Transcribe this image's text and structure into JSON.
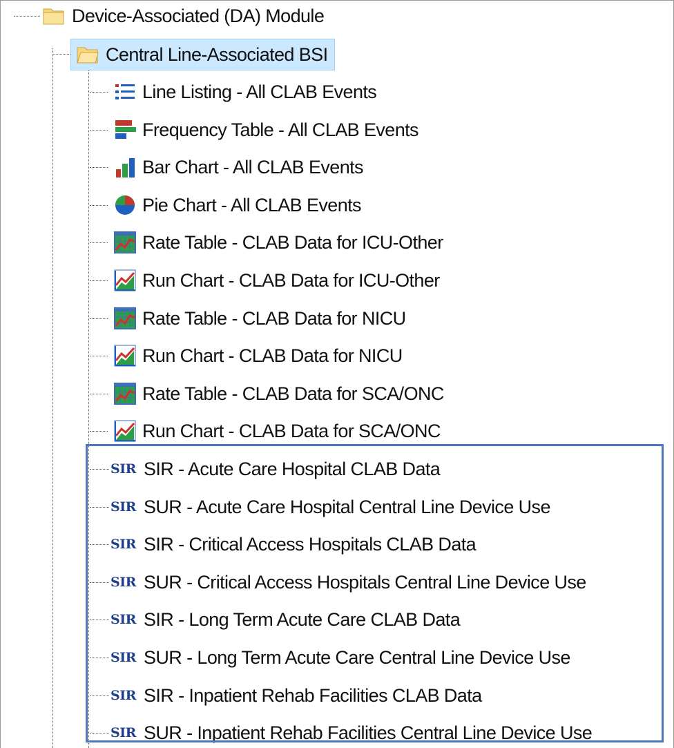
{
  "tree": {
    "root": {
      "label": "Device-Associated (DA) Module",
      "icon": "folder-icon"
    },
    "folder": {
      "label": "Central Line-Associated BSI",
      "icon": "folder-open-icon",
      "selected": true
    },
    "items": [
      {
        "label": "Line Listing - All CLAB Events",
        "icon": "line-listing-icon"
      },
      {
        "label": "Frequency Table - All CLAB Events",
        "icon": "frequency-table-icon"
      },
      {
        "label": "Bar Chart - All CLAB Events",
        "icon": "bar-chart-icon"
      },
      {
        "label": "Pie Chart - All CLAB Events",
        "icon": "pie-chart-icon"
      },
      {
        "label": "Rate Table - CLAB Data for ICU-Other",
        "icon": "rate-table-icon"
      },
      {
        "label": "Run Chart - CLAB Data for ICU-Other",
        "icon": "run-chart-icon"
      },
      {
        "label": "Rate Table - CLAB Data for NICU",
        "icon": "rate-table-icon"
      },
      {
        "label": "Run Chart - CLAB Data for NICU",
        "icon": "run-chart-icon"
      },
      {
        "label": "Rate Table - CLAB Data for SCA/ONC",
        "icon": "rate-table-icon"
      },
      {
        "label": "Run Chart - CLAB Data for SCA/ONC",
        "icon": "run-chart-icon"
      },
      {
        "label": "SIR - Acute Care Hospital CLAB Data",
        "icon": "sir-icon",
        "badge": "SIR"
      },
      {
        "label": "SUR - Acute Care Hospital Central Line Device Use",
        "icon": "sir-icon",
        "badge": "SIR"
      },
      {
        "label": "SIR - Critical Access Hospitals CLAB Data",
        "icon": "sir-icon",
        "badge": "SIR"
      },
      {
        "label": "SUR - Critical Access Hospitals Central Line Device Use",
        "icon": "sir-icon",
        "badge": "SIR"
      },
      {
        "label": "SIR - Long Term Acute Care CLAB Data",
        "icon": "sir-icon",
        "badge": "SIR"
      },
      {
        "label": "SUR - Long Term Acute Care Central Line Device Use",
        "icon": "sir-icon",
        "badge": "SIR"
      },
      {
        "label": "SIR - Inpatient Rehab Facilities CLAB Data",
        "icon": "sir-icon",
        "badge": "SIR"
      },
      {
        "label": "SUR - Inpatient Rehab Facilities Central Line Device Use",
        "icon": "sir-icon",
        "badge": "SIR"
      }
    ]
  },
  "colors": {
    "selection_bg": "#cce8ff",
    "highlight_border": "#4f74bf",
    "sir_badge": "#1f3f8c"
  }
}
